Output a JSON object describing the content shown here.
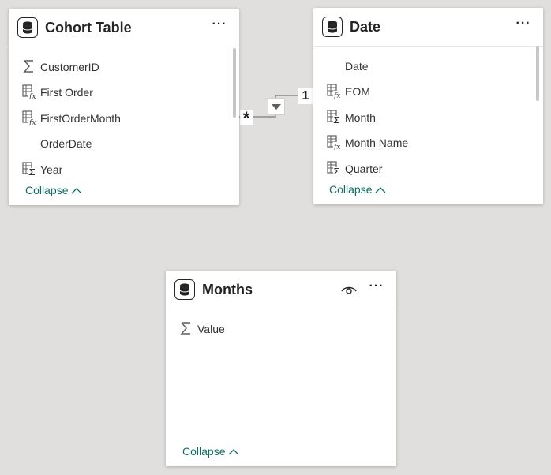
{
  "tables": {
    "cohort": {
      "title": "Cohort Table",
      "fields": [
        {
          "icon": "sigma-icon",
          "label": "CustomerID"
        },
        {
          "icon": "calculated-column-icon",
          "label": "First Order"
        },
        {
          "icon": "calculated-column-icon",
          "label": "FirstOrderMonth"
        },
        {
          "icon": "",
          "label": "OrderDate"
        },
        {
          "icon": "hierarchy-sum-icon",
          "label": "Year"
        }
      ],
      "collapse_label": "Collapse"
    },
    "date": {
      "title": "Date",
      "fields": [
        {
          "icon": "",
          "label": "Date"
        },
        {
          "icon": "calculated-column-icon",
          "label": "EOM"
        },
        {
          "icon": "hierarchy-sum-icon",
          "label": "Month"
        },
        {
          "icon": "calculated-column-icon",
          "label": "Month Name"
        },
        {
          "icon": "hierarchy-sum-icon",
          "label": "Quarter"
        }
      ],
      "collapse_label": "Collapse"
    },
    "months": {
      "title": "Months",
      "fields": [
        {
          "icon": "sigma-icon",
          "label": "Value"
        }
      ],
      "collapse_label": "Collapse"
    }
  },
  "relationship": {
    "many_side": "*",
    "one_side": "1"
  },
  "colors": {
    "canvas": "#e1dfdd",
    "card": "#ffffff",
    "accent": "#106d63",
    "text": "#252423"
  }
}
